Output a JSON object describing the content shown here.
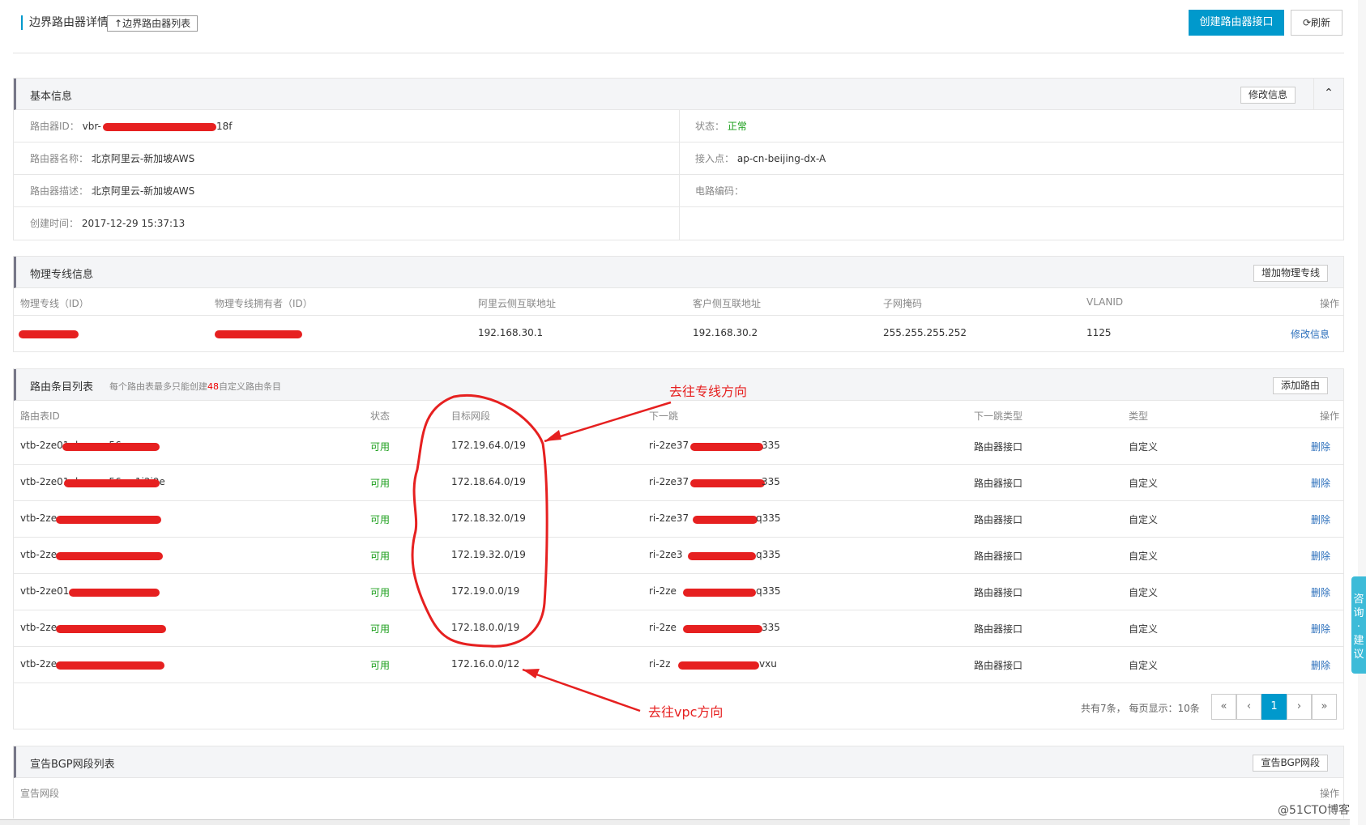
{
  "header": {
    "title": "边界路由器详情",
    "back_label": "边界路由器列表",
    "create_label": "创建路由器接口",
    "refresh_label": "刷新"
  },
  "basic_info": {
    "title": "基本信息",
    "edit_label": "修改信息",
    "collapse_icon": "chevron-up-icon",
    "router_id_label": "路由器ID：",
    "router_id_value": "vbr-",
    "router_id_suffix": "18f",
    "status_label": "状态：",
    "status_value": "正常",
    "name_label": "路由器名称：",
    "name_value": "北京阿里云-新加坡AWS",
    "access_label": "接入点：",
    "access_value": "ap-cn-beijing-dx-A",
    "desc_label": "路由器描述：",
    "desc_value": "北京阿里云-新加坡AWS",
    "circuit_label": "电路编码：",
    "created_label": "创建时间：",
    "created_value": "2017-12-29 15:37:13"
  },
  "physical": {
    "title": "物理专线信息",
    "add_label": "增加物理专线",
    "columns": [
      "物理专线（ID）",
      "物理专线拥有者（ID）",
      "阿里云侧互联地址",
      "客户侧互联地址",
      "子网掩码",
      "VLANID",
      "操作"
    ],
    "row": {
      "aliyun_ip": "192.168.30.1",
      "customer_ip": "192.168.30.2",
      "mask": "255.255.255.252",
      "vlan": "1125",
      "action": "修改信息"
    }
  },
  "routes": {
    "title": "路由条目列表",
    "note_prefix": "每个路由表最多只能创建",
    "note_count": "48",
    "note_suffix": "自定义路由条目",
    "add_label": "添加路由",
    "columns": [
      "路由表ID",
      "状态",
      "目标网段",
      "下一跳",
      "下一跳类型",
      "类型",
      "操作"
    ],
    "rows": [
      {
        "id": "vtb-2ze01nkpppm56wo",
        "status": "可用",
        "cidr": "172.19.64.0/19",
        "next": "ri-2ze37",
        "next_suffix": "335",
        "next_type": "路由器接口",
        "type": "自定义",
        "action": "删除"
      },
      {
        "id": "vtb-2ze01nkpppm56wo1i2i9e",
        "status": "可用",
        "cidr": "172.18.64.0/19",
        "next": "ri-2ze37",
        "next_suffix": "335",
        "next_type": "路由器接口",
        "type": "自定义",
        "action": "删除"
      },
      {
        "id": "vtb-2ze",
        "status": "可用",
        "cidr": "172.18.32.0/19",
        "next": "ri-2ze37",
        "next_suffix": "q335",
        "next_type": "路由器接口",
        "type": "自定义",
        "action": "删除"
      },
      {
        "id": "vtb-2ze",
        "status": "可用",
        "cidr": "172.19.32.0/19",
        "next": "ri-2ze3",
        "next_suffix": "q335",
        "next_type": "路由器接口",
        "type": "自定义",
        "action": "删除"
      },
      {
        "id": "vtb-2ze01",
        "status": "可用",
        "cidr": "172.19.0.0/19",
        "next": "ri-2ze",
        "next_suffix": "q335",
        "next_type": "路由器接口",
        "type": "自定义",
        "action": "删除"
      },
      {
        "id": "vtb-2ze",
        "status": "可用",
        "cidr": "172.18.0.0/19",
        "next": "ri-2ze",
        "next_suffix": "335",
        "next_type": "路由器接口",
        "type": "自定义",
        "action": "删除"
      },
      {
        "id": "vtb-2ze",
        "status": "可用",
        "cidr": "172.16.0.0/12",
        "next": "ri-2z",
        "next_suffix": "vxu",
        "next_type": "路由器接口",
        "type": "自定义",
        "action": "删除"
      }
    ],
    "pager": {
      "info": "共有7条， 每页显示：10条",
      "first": "«",
      "prev": "‹",
      "current": "1",
      "next": "›",
      "last": "»"
    }
  },
  "bgp": {
    "title": "宣告BGP网段列表",
    "add_label": "宣告BGP网段",
    "col_network": "宣告网段",
    "col_action": "操作"
  },
  "annotations": {
    "dedicated": "去往专线方向",
    "vpc": "去往vpc方向"
  },
  "side_float": "咨询·建议",
  "watermark": "@51CTO博客",
  "colors": {
    "primary": "#0099cc",
    "ok": "#1a9e1a",
    "link": "#2a6ebb",
    "annotation": "#e62020"
  }
}
